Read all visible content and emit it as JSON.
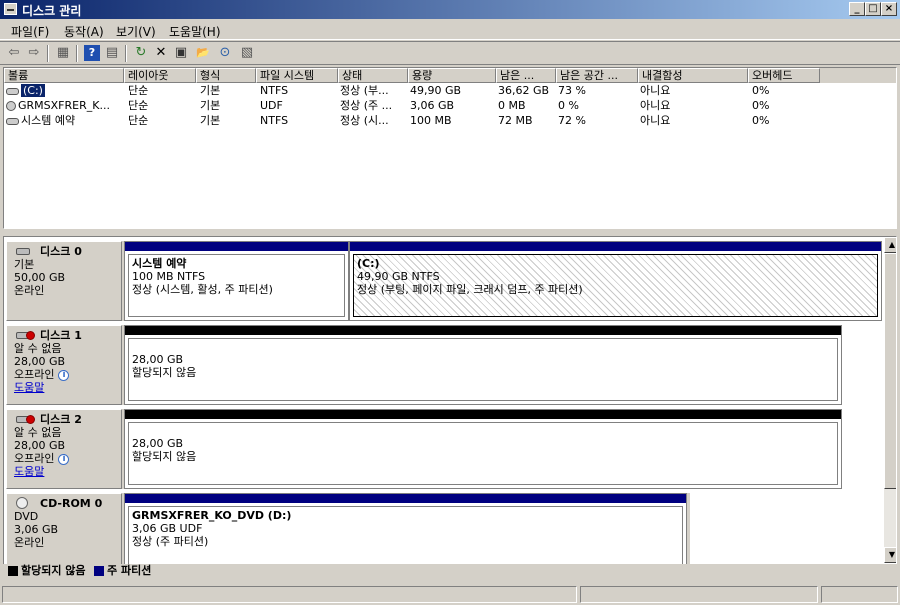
{
  "window": {
    "title": "디스크 관리",
    "min": "_",
    "max": "□",
    "close": "×"
  },
  "menu": [
    "파일(F)",
    "동작(A)",
    "보기(V)",
    "도움말(H)"
  ],
  "toolbar": {
    "icons": [
      "back-icon",
      "forward-icon",
      "view-icon",
      "help-icon",
      "console-icon",
      "refresh-icon",
      "delete-icon",
      "properties-icon",
      "open-icon",
      "search-icon",
      "export-icon"
    ],
    "glyphs": {
      "back": "⇦",
      "forward": "⇨",
      "view": "▦",
      "help": "?",
      "console": "▤",
      "refresh": "↻",
      "delete": "✕",
      "properties": "▣",
      "open": "📂",
      "search": "⊙",
      "export": "▧"
    }
  },
  "volumes": {
    "columns": [
      "볼륨",
      "레이아웃",
      "형식",
      "파일 시스템",
      "상태",
      "용량",
      "남은 ...",
      "남은 공간 ...",
      "내결함성",
      "오버헤드"
    ],
    "rows": [
      {
        "name": "(C:)",
        "layout": "단순",
        "type": "기본",
        "fs": "NTFS",
        "status": "정상 (부...",
        "capacity": "49,90 GB",
        "free": "36,62 GB",
        "pct": "73 %",
        "ft": "아니요",
        "overhead": "0%"
      },
      {
        "name": "GRMSXFRER_K...",
        "layout": "단순",
        "type": "기본",
        "fs": "UDF",
        "status": "정상 (주 ...",
        "capacity": "3,06 GB",
        "free": "0 MB",
        "pct": "0 %",
        "ft": "아니요",
        "overhead": "0%"
      },
      {
        "name": "시스템 예약",
        "layout": "단순",
        "type": "기본",
        "fs": "NTFS",
        "status": "정상 (시...",
        "capacity": "100 MB",
        "free": "72 MB",
        "pct": "72 %",
        "ft": "아니요",
        "overhead": "0%"
      }
    ]
  },
  "disks": [
    {
      "name": "디스크 0",
      "kind": "기본",
      "size": "50,00 GB",
      "state": "온라인",
      "partitions": [
        {
          "label": "시스템 예약",
          "detail": "100 MB NTFS",
          "status": "정상 (시스템, 활성, 주 파티션)"
        },
        {
          "label": "(C:)",
          "detail": "49,90 GB NTFS",
          "status": "정상 (부팅, 페이지 파일, 크래시 덤프, 주 파티션)"
        }
      ]
    },
    {
      "name": "디스크 1",
      "kind": "알 수 없음",
      "size": "28,00 GB",
      "state": "오프라인",
      "help": "도움말",
      "partitions": [
        {
          "detail": "28,00 GB",
          "status": "할당되지 않음"
        }
      ]
    },
    {
      "name": "디스크 2",
      "kind": "알 수 없음",
      "size": "28,00 GB",
      "state": "오프라인",
      "help": "도움말",
      "partitions": [
        {
          "detail": "28,00 GB",
          "status": "할당되지 않음"
        }
      ]
    },
    {
      "name": "CD-ROM 0",
      "kind": "DVD",
      "size": "3,06 GB",
      "state": "온라인",
      "partitions": [
        {
          "label": "GRMSXFRER_KO_DVD  (D:)",
          "detail": "3,06 GB UDF",
          "status": "정상 (주 파티션)"
        }
      ]
    }
  ],
  "legend": {
    "unallocated": "할당되지 않음",
    "primary": "주 파티션"
  },
  "colors": {
    "primary": "#000080",
    "unallocated": "#000000",
    "titlebar": "#0a246a"
  },
  "scroll": {
    "up": "▲",
    "down": "▼"
  },
  "info_glyph": "i"
}
